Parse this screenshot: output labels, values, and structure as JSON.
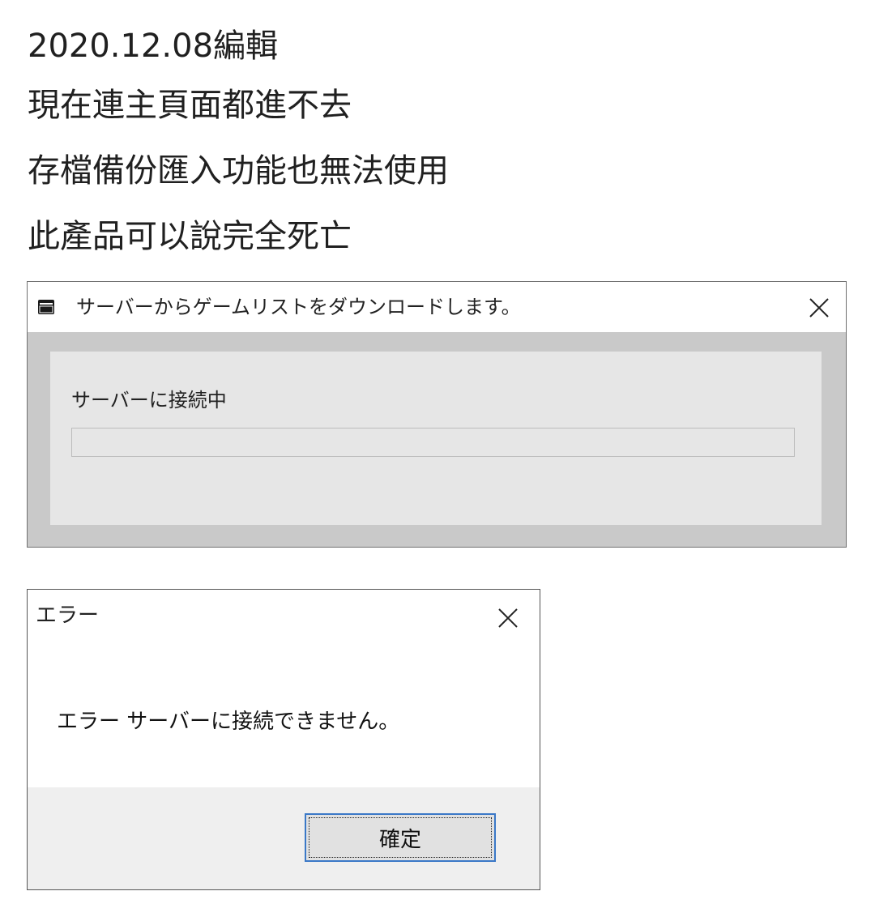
{
  "post": {
    "lines": [
      "2020.12.08編輯",
      "現在連主頁面都進不去",
      "存檔備份匯入功能也無法使用",
      "此產品可以說完全死亡"
    ]
  },
  "download_dialog": {
    "title": "サーバーからゲームリストをダウンロードします。",
    "icon": "app-window-icon",
    "status": "サーバーに接続中",
    "progress": 0
  },
  "error_dialog": {
    "title": "エラー",
    "message": "エラー サーバーに接続できません。",
    "ok_label": "確定"
  },
  "colors": {
    "dialog_frame": "#c9c9c9",
    "dialog_content": "#e6e6e6",
    "button_focus_border": "#3a78c7",
    "progress_fill": "#06b025"
  }
}
